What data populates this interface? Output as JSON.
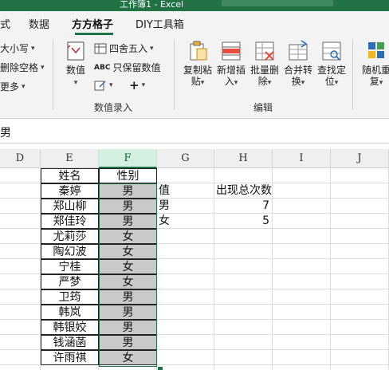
{
  "titlebar": {
    "title": "工作簿1 - Excel"
  },
  "tabs": [
    {
      "label": "式"
    },
    {
      "label": "数据"
    },
    {
      "label": "方方格子",
      "active": true
    },
    {
      "label": "DIY工具箱"
    }
  ],
  "ribbon": {
    "left_items": [
      "大小写",
      "删除空格",
      "更多"
    ],
    "numeric": {
      "label": "数值",
      "round_label": "四舍五入",
      "keep_label": "只保留数值",
      "plus": "+",
      "group_label": "数值录入"
    },
    "edit": {
      "buttons": [
        {
          "label1": "复制粘",
          "label2": "贴"
        },
        {
          "label1": "新增插",
          "label2": "入"
        },
        {
          "label1": "批量删",
          "label2": "除"
        },
        {
          "label1": "合并转",
          "label2": "换"
        },
        {
          "label1": "查找定",
          "label2": "位"
        }
      ],
      "group_label": "编辑"
    },
    "random": {
      "label1": "随机重",
      "label2": "复"
    }
  },
  "formula_bar": {
    "value": "男"
  },
  "columns": [
    "D",
    "E",
    "F",
    "G",
    "H",
    "I",
    "J"
  ],
  "rows": [
    {
      "E": "姓名",
      "F": "性别",
      "G": "",
      "H": ""
    },
    {
      "E": "秦婷",
      "F": "男",
      "G": "值",
      "H": "出现总次数"
    },
    {
      "E": "郑山柳",
      "F": "男",
      "G": "男",
      "H": "7"
    },
    {
      "E": "郑佳玲",
      "F": "男",
      "G": "女",
      "H": "5"
    },
    {
      "E": "尤莉莎",
      "F": "女",
      "G": "",
      "H": ""
    },
    {
      "E": "陶幻波",
      "F": "女",
      "G": "",
      "H": ""
    },
    {
      "E": "宁桂",
      "F": "女",
      "G": "",
      "H": ""
    },
    {
      "E": "严梦",
      "F": "女",
      "G": "",
      "H": ""
    },
    {
      "E": "卫筠",
      "F": "男",
      "G": "",
      "H": ""
    },
    {
      "E": "韩岚",
      "F": "男",
      "G": "",
      "H": ""
    },
    {
      "E": "韩银姣",
      "F": "男",
      "G": "",
      "H": ""
    },
    {
      "E": "钱涵菡",
      "F": "男",
      "G": "",
      "H": ""
    },
    {
      "E": "许雨祺",
      "F": "女",
      "G": "",
      "H": ""
    }
  ],
  "colors": {
    "accent": "#217346",
    "selection_fill": "#c9c9c9"
  }
}
